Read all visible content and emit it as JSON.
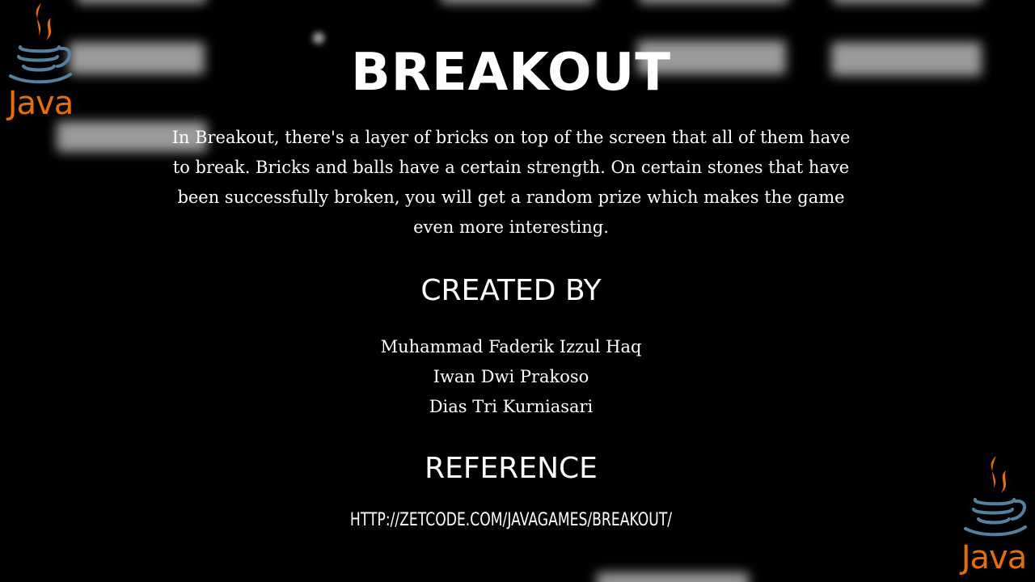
{
  "colors": {
    "background": "#000000",
    "text": "#ffffff",
    "java_orange": "#e76f00",
    "java_blue": "#5382a1",
    "brick": "#cfcfcf"
  },
  "logos": {
    "top_left": {
      "icon": "java-coffee-cup-icon",
      "word": "Java"
    },
    "bottom_right": {
      "icon": "java-coffee-cup-icon",
      "word": "Java"
    }
  },
  "title": "BREAKOUT",
  "description": "In Breakout, there's a layer of bricks on top of the screen that all of them have to break. Bricks and balls have a certain strength. On certain stones that have been successfully broken, you will get a random prize which makes the game even more interesting.",
  "created_by": {
    "heading": "CREATED BY",
    "authors": [
      "Muhammad Faderik Izzul Haq",
      "Iwan Dwi Prakoso",
      "Dias Tri Kurniasari"
    ]
  },
  "reference": {
    "heading": "REFERENCE",
    "link": "HTTP://ZETCODE.COM/JAVAGAMES/BREAKOUT/"
  }
}
